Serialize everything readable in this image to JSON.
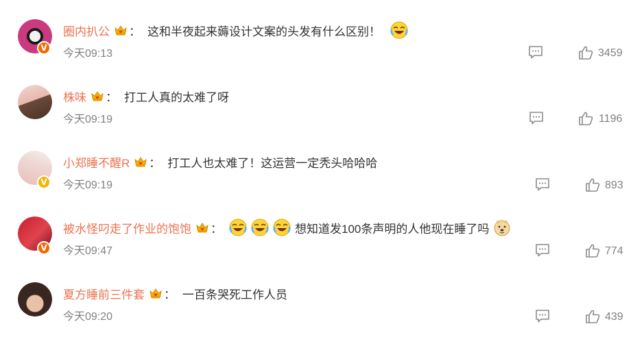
{
  "comments": [
    {
      "username": "圈内扒公",
      "content": "这和半夜起来薅设计文案的头发有什么区别！",
      "time": "今天09:13",
      "likes": "3459",
      "badge": "orange"
    },
    {
      "username": "株味",
      "content": "打工人真的太难了呀",
      "time": "今天09:19",
      "likes": "1196",
      "badge": ""
    },
    {
      "username": "小郑睡不醒R",
      "content": "打工人也太难了！这运营一定秃头哈哈哈",
      "time": "今天09:19",
      "likes": "893",
      "badge": "gold"
    },
    {
      "username": "被水怪叼走了作业的饱饱",
      "content": "想知道发100条声明的人他现在睡了吗",
      "time": "今天09:47",
      "likes": "774",
      "badge": "orange"
    },
    {
      "username": "夏方睡前三件套",
      "content": "一百条哭死工作人员",
      "time": "今天09:20",
      "likes": "439",
      "badge": ""
    }
  ],
  "colon": "：",
  "badge_letter": "V",
  "icons": {
    "crown": "crown-icon",
    "laugh": "laugh-cry-emoji",
    "doge": "doge-emoji",
    "reply": "comment-reply-icon",
    "like": "thumbs-up-icon"
  },
  "colors": {
    "username": "#eb7350",
    "text": "#333333",
    "meta": "#808080",
    "badge_gold": "#f5b400",
    "badge_orange": "#f06a00"
  }
}
